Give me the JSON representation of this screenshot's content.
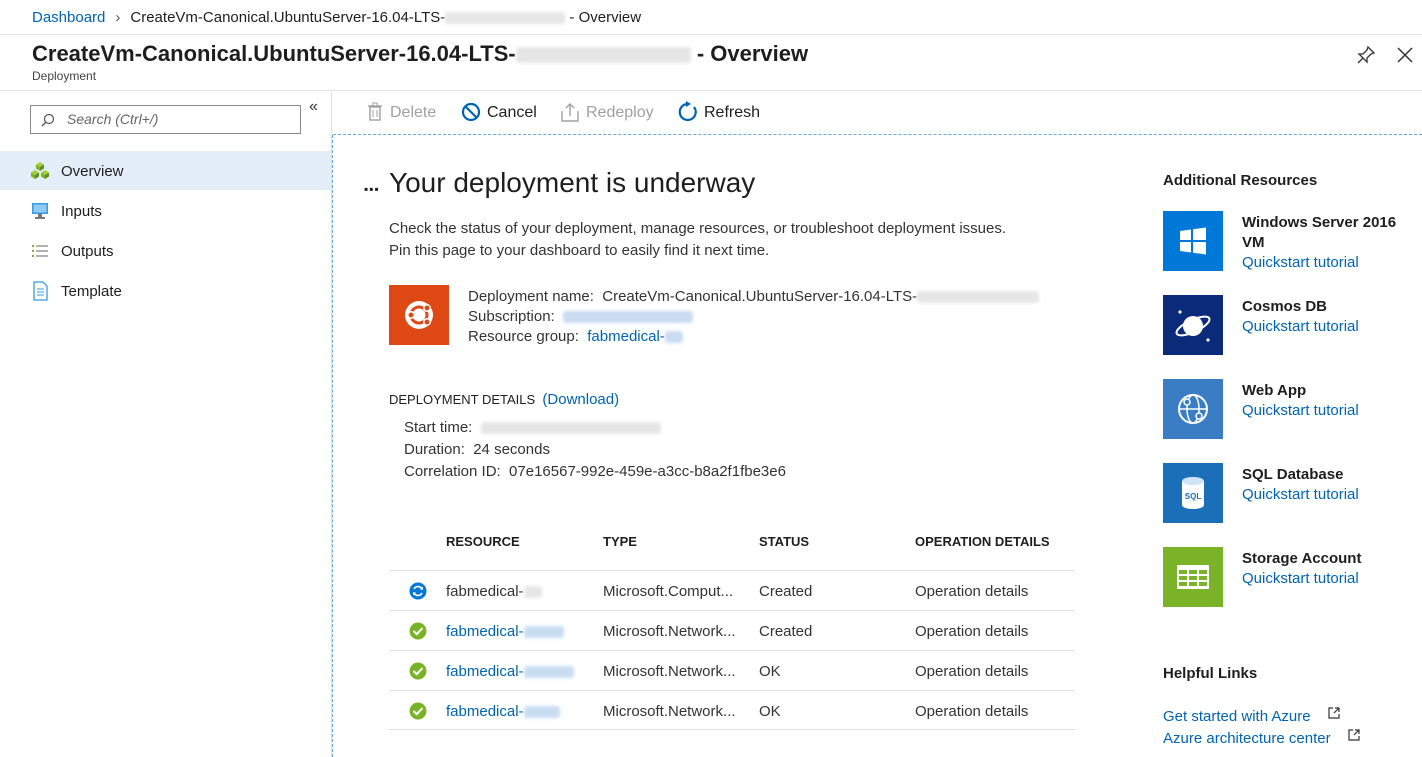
{
  "breadcrumb": {
    "home": "Dashboard",
    "current_prefix": "CreateVm-Canonical.UbuntuServer-16.04-LTS-",
    "current_suffix": " - Overview"
  },
  "header": {
    "title_prefix": "CreateVm-Canonical.UbuntuServer-16.04-LTS-",
    "title_suffix": " - Overview",
    "subtitle": "Deployment"
  },
  "sidebar": {
    "search_placeholder": "Search (Ctrl+/)",
    "items": [
      {
        "label": "Overview",
        "icon": "overview-cubes-icon",
        "active": true
      },
      {
        "label": "Inputs",
        "icon": "inputs-monitor-icon"
      },
      {
        "label": "Outputs",
        "icon": "outputs-list-icon"
      },
      {
        "label": "Template",
        "icon": "template-document-icon"
      }
    ]
  },
  "toolbar": {
    "delete": "Delete",
    "cancel": "Cancel",
    "redeploy": "Redeploy",
    "refresh": "Refresh"
  },
  "main": {
    "heading": "Your deployment is underway",
    "desc_line1": "Check the status of your deployment, manage resources, or troubleshoot deployment issues.",
    "desc_line2": "Pin this page to your dashboard to easily find it next time.",
    "deployment_name_label": "Deployment name:",
    "deployment_name_value": "CreateVm-Canonical.UbuntuServer-16.04-LTS-",
    "subscription_label": "Subscription:",
    "resource_group_label": "Resource group:",
    "resource_group_value": "fabmedical-",
    "details_title": "DEPLOYMENT DETAILS",
    "download": "(Download)",
    "start_time_label": "Start time:",
    "duration_label": "Duration:",
    "duration_value": "24 seconds",
    "correlation_label": "Correlation ID:",
    "correlation_value": "07e16567-992e-459e-a3cc-b8a2f1fbe3e6"
  },
  "table": {
    "headers": [
      "RESOURCE",
      "TYPE",
      "STATUS",
      "OPERATION DETAILS"
    ],
    "rows": [
      {
        "resource": "fabmedical-",
        "type": "Microsoft.Comput...",
        "status": "Created",
        "op": "Operation details",
        "icon": "in-progress-icon",
        "link": false
      },
      {
        "resource": "fabmedical-",
        "type": "Microsoft.Network...",
        "status": "Created",
        "op": "Operation details",
        "icon": "success-check-icon",
        "link": true
      },
      {
        "resource": "fabmedical-",
        "type": "Microsoft.Network...",
        "status": "OK",
        "op": "Operation details",
        "icon": "success-check-icon",
        "link": true
      },
      {
        "resource": "fabmedical-",
        "type": "Microsoft.Network...",
        "status": "OK",
        "op": "Operation details",
        "icon": "success-check-icon",
        "link": true
      }
    ]
  },
  "right": {
    "additional_title": "Additional Resources",
    "resources": [
      {
        "name": "Windows Server 2016 VM",
        "link": "Quickstart tutorial",
        "icon": "windows-icon",
        "color": "#0078d7"
      },
      {
        "name": "Cosmos DB",
        "link": "Quickstart tutorial",
        "icon": "cosmos-planet-icon",
        "color": "#0b2a7a"
      },
      {
        "name": "Web App",
        "link": "Quickstart tutorial",
        "icon": "web-app-globe-icon",
        "color": "#3b7dc4"
      },
      {
        "name": "SQL Database",
        "link": "Quickstart tutorial",
        "icon": "sql-database-icon",
        "color": "#1a6fb8"
      },
      {
        "name": "Storage Account",
        "link": "Quickstart tutorial",
        "icon": "storage-table-icon",
        "color": "#7ab327"
      }
    ],
    "helpful_title": "Helpful Links",
    "helpful_links": [
      "Get started with Azure",
      "Azure architecture center"
    ]
  },
  "colors": {
    "accent": "#0063b1",
    "success": "#7ab327",
    "ubuntu": "#dd4814"
  }
}
